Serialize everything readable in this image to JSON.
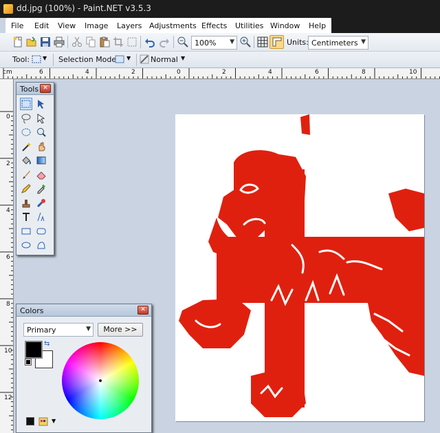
{
  "window": {
    "title": "dd.jpg (100%) - Paint.NET v3.5.3"
  },
  "menu": [
    "File",
    "Edit",
    "View",
    "Image",
    "Layers",
    "Adjustments",
    "Effects",
    "Utilities",
    "Window",
    "Help"
  ],
  "toolbar": {
    "zoom_value": "100%",
    "units_label": "Units:",
    "units_value": "Centimeters"
  },
  "toolbar2": {
    "tool_label": "Tool:",
    "selection_mode_label": "Selection Mode:",
    "blend_mode": "Normal"
  },
  "ruler": {
    "unit": "cm",
    "top_labels": [
      "6",
      "4",
      "2",
      "0",
      "2",
      "4",
      "6",
      "8",
      "10"
    ],
    "left_labels": [
      "0",
      "2",
      "4",
      "6",
      "8",
      "10",
      "12"
    ]
  },
  "tools_panel": {
    "title": "Tools",
    "tools": [
      "rectangle-select",
      "move-selection",
      "lasso-select",
      "move-selected",
      "ellipse-select",
      "zoom",
      "magic-wand",
      "pan",
      "paint-bucket",
      "gradient",
      "paintbrush",
      "eraser",
      "pencil",
      "color-picker",
      "clone-stamp",
      "recolor",
      "text",
      "line-curve",
      "rectangle",
      "rounded-rectangle",
      "ellipse",
      "freeform-shape"
    ]
  },
  "colors_panel": {
    "title": "Colors",
    "mode_value": "Primary",
    "more_button": "More >>",
    "primary_color": "#000000",
    "secondary_color": "#ffffff"
  },
  "image": {
    "flag_color": "#e0200f"
  }
}
